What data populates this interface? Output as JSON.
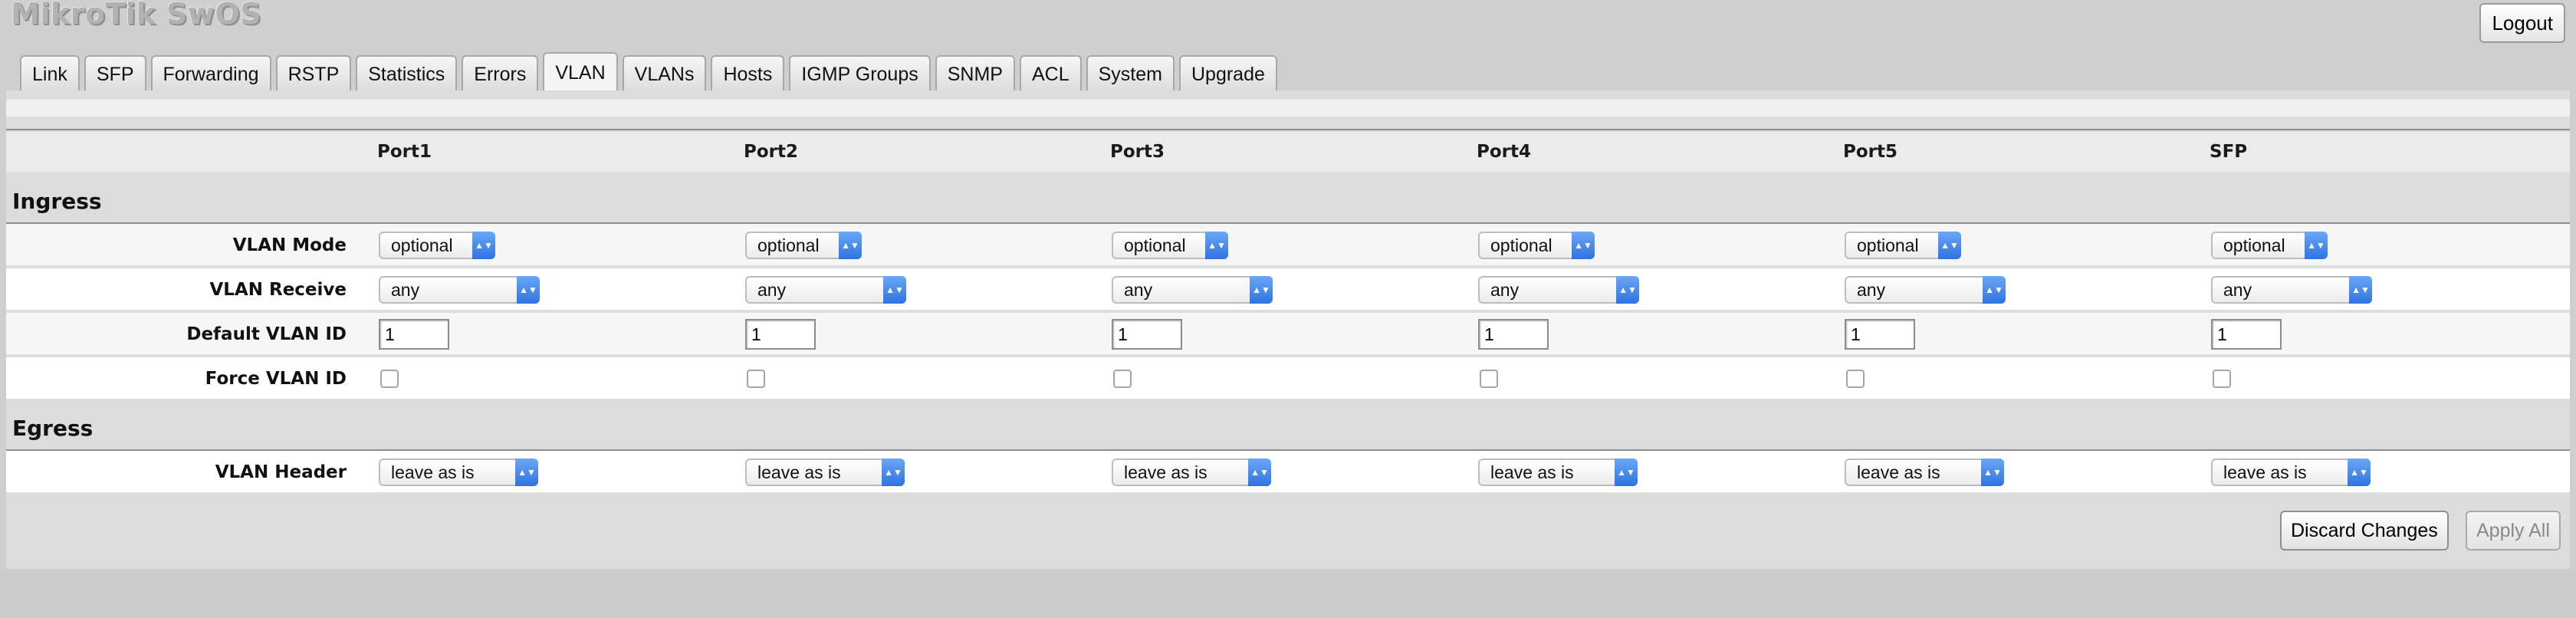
{
  "app": {
    "title": "MikroTik SwOS",
    "logout_label": "Logout"
  },
  "tabs": [
    "Link",
    "SFP",
    "Forwarding",
    "RSTP",
    "Statistics",
    "Errors",
    "VLAN",
    "VLANs",
    "Hosts",
    "IGMP Groups",
    "SNMP",
    "ACL",
    "System",
    "Upgrade"
  ],
  "active_tab": "VLAN",
  "ports": [
    "Port1",
    "Port2",
    "Port3",
    "Port4",
    "Port5",
    "SFP"
  ],
  "ingress": {
    "title": "Ingress",
    "vlan_mode": {
      "label": "VLAN Mode",
      "values": [
        "optional",
        "optional",
        "optional",
        "optional",
        "optional",
        "optional"
      ]
    },
    "vlan_receive": {
      "label": "VLAN Receive",
      "values": [
        "any",
        "any",
        "any",
        "any",
        "any",
        "any"
      ]
    },
    "default_vlan_id": {
      "label": "Default VLAN ID",
      "values": [
        "1",
        "1",
        "1",
        "1",
        "1",
        "1"
      ]
    },
    "force_vlan_id": {
      "label": "Force VLAN ID",
      "values": [
        false,
        false,
        false,
        false,
        false,
        false
      ]
    }
  },
  "egress": {
    "title": "Egress",
    "vlan_header": {
      "label": "VLAN Header",
      "values": [
        "leave as is",
        "leave as is",
        "leave as is",
        "leave as is",
        "leave as is",
        "leave as is"
      ]
    }
  },
  "actions": {
    "discard_label": "Discard Changes",
    "apply_label": "Apply All"
  },
  "colors": {
    "select_arrow": "#3b82e8",
    "panel": "#dcdcdc",
    "title_text": "#b2b2b2"
  }
}
